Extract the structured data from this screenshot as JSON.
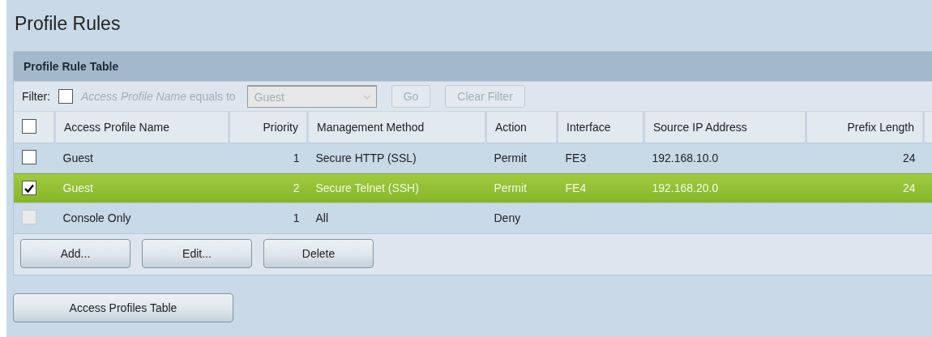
{
  "title": "Profile Rules",
  "panel": {
    "title": "Profile Rule Table",
    "filter": {
      "label": "Filter:",
      "checked": false,
      "field_label": "*Access Profile Name* equals to",
      "select_value": "Guest",
      "go_button": "Go",
      "clear_button": "Clear Filter",
      "disabled": true
    },
    "select_all_checked": false,
    "columns": [
      "Access Profile Name",
      "Priority",
      "Management Method",
      "Action",
      "Interface",
      "Source IP Address",
      "Prefix Length"
    ],
    "rows": [
      {
        "selected": false,
        "checked": false,
        "disabled": false,
        "cells": [
          "Guest",
          "1",
          "Secure HTTP (SSL)",
          "Permit",
          "FE3",
          "192.168.10.0",
          "24"
        ]
      },
      {
        "selected": true,
        "checked": true,
        "disabled": false,
        "cells": [
          "Guest",
          "2",
          "Secure Telnet (SSH)",
          "Permit",
          "FE4",
          "192.168.20.0",
          "24"
        ]
      },
      {
        "selected": false,
        "checked": false,
        "disabled": true,
        "cells": [
          "Console Only",
          "1",
          "All",
          "Deny",
          "",
          "",
          ""
        ]
      }
    ],
    "buttons": [
      "Add...",
      "Edit...",
      "Delete"
    ]
  },
  "bottom_button": "Access Profiles Table"
}
